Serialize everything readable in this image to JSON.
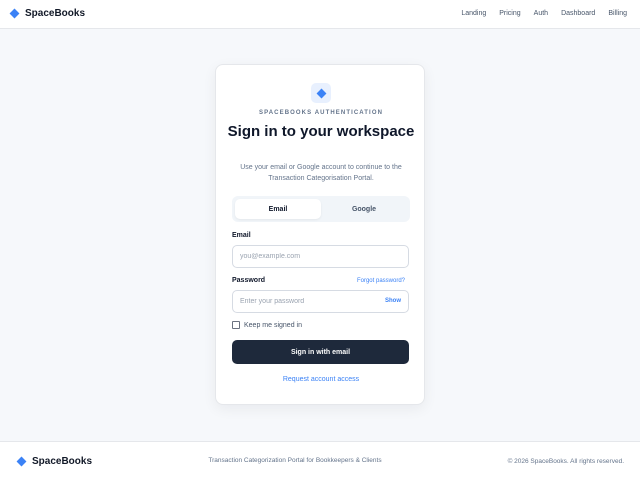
{
  "header": {
    "brand": "SpaceBooks",
    "nav": [
      "Landing",
      "Pricing",
      "Auth",
      "Dashboard",
      "Billing"
    ]
  },
  "card": {
    "eyebrow": "SPACEBOOKS AUTHENTICATION",
    "title": "Sign in to your workspace",
    "subtitle": "Use your email or Google account to continue to the Transaction Categorisation Portal.",
    "tabs": [
      "Email",
      "Google"
    ],
    "active_tab": "Email",
    "email_label": "Email",
    "email_placeholder": "you@example.com",
    "email_value": "",
    "password_label": "Password",
    "forgot_link": "Forgot password?",
    "password_placeholder": "Enter your password",
    "password_value": "",
    "show_label": "Show",
    "remember_label": "Keep me signed in",
    "remember_checked": false,
    "submit_label": "Sign in with email",
    "request_link": "Request account access"
  },
  "footer": {
    "brand": "SpaceBooks",
    "tagline": "Transaction Categorization Portal for Bookkeepers & Clients",
    "copyright": "© 2026 SpaceBooks. All rights reserved."
  },
  "colors": {
    "accent": "#3b82f6",
    "primary_button": "#1e293b",
    "background": "#f6f8fb"
  },
  "icons": {
    "brand": "diamond-logo-icon"
  }
}
